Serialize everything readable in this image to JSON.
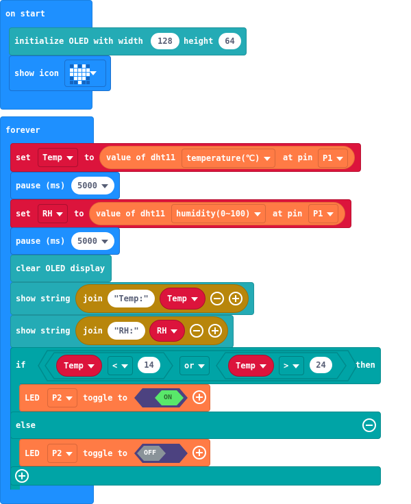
{
  "on_start": {
    "label": "on start",
    "init_oled": {
      "label": "initialize OLED with width",
      "width_value": "128",
      "height_label": "height",
      "height_value": "64"
    },
    "show_icon": {
      "label": "show icon",
      "icon": "heart-icon",
      "icon_grid": [
        [
          0,
          1,
          0,
          1,
          0
        ],
        [
          1,
          1,
          1,
          1,
          1
        ],
        [
          1,
          1,
          1,
          1,
          1
        ],
        [
          0,
          1,
          1,
          1,
          0
        ],
        [
          0,
          0,
          1,
          0,
          0
        ]
      ]
    }
  },
  "forever": {
    "label": "forever",
    "set_temp": {
      "set_label": "set",
      "variable": "Temp",
      "to_label": "to",
      "reporter_label": "value of dht11",
      "measure": "temperature(℃)",
      "pin_label": "at pin",
      "pin": "P1"
    },
    "pause1": {
      "label": "pause (ms)",
      "value": "5000"
    },
    "set_rh": {
      "set_label": "set",
      "variable": "RH",
      "to_label": "to",
      "reporter_label": "value of dht11",
      "measure": "humidity(0~100)",
      "pin_label": "at pin",
      "pin": "P1"
    },
    "pause2": {
      "label": "pause (ms)",
      "value": "5000"
    },
    "clear_oled": {
      "label": "clear OLED display"
    },
    "show_string1": {
      "label": "show string",
      "join_label": "join",
      "text": "\"Temp:\"",
      "variable": "Temp"
    },
    "show_string2": {
      "label": "show string",
      "join_label": "join",
      "text": "\"RH:\"",
      "variable": "RH"
    },
    "if_block": {
      "if_label": "if",
      "cond1": {
        "variable": "Temp",
        "operator": "<",
        "value": "14"
      },
      "logic": "or",
      "cond2": {
        "variable": "Temp",
        "operator": ">",
        "value": "24"
      },
      "then_label": "then",
      "then_led": {
        "label": "LED",
        "pin": "P2",
        "toggle_label": "toggle to",
        "state": "ON"
      },
      "else_label": "else",
      "else_led": {
        "label": "LED",
        "pin": "P2",
        "toggle_label": "toggle to",
        "state": "OFF"
      }
    }
  },
  "colors": {
    "events_blue": "#1e90ff",
    "oled_teal": "#24abb5",
    "variables_red": "#dc143c",
    "dht_orange": "#ff7b45",
    "text_gold": "#b8860b",
    "logic_teal": "#00a4a6",
    "toggle_purple": "#4c4280",
    "on_green": "#59e86a",
    "off_gray": "#8a9399"
  }
}
